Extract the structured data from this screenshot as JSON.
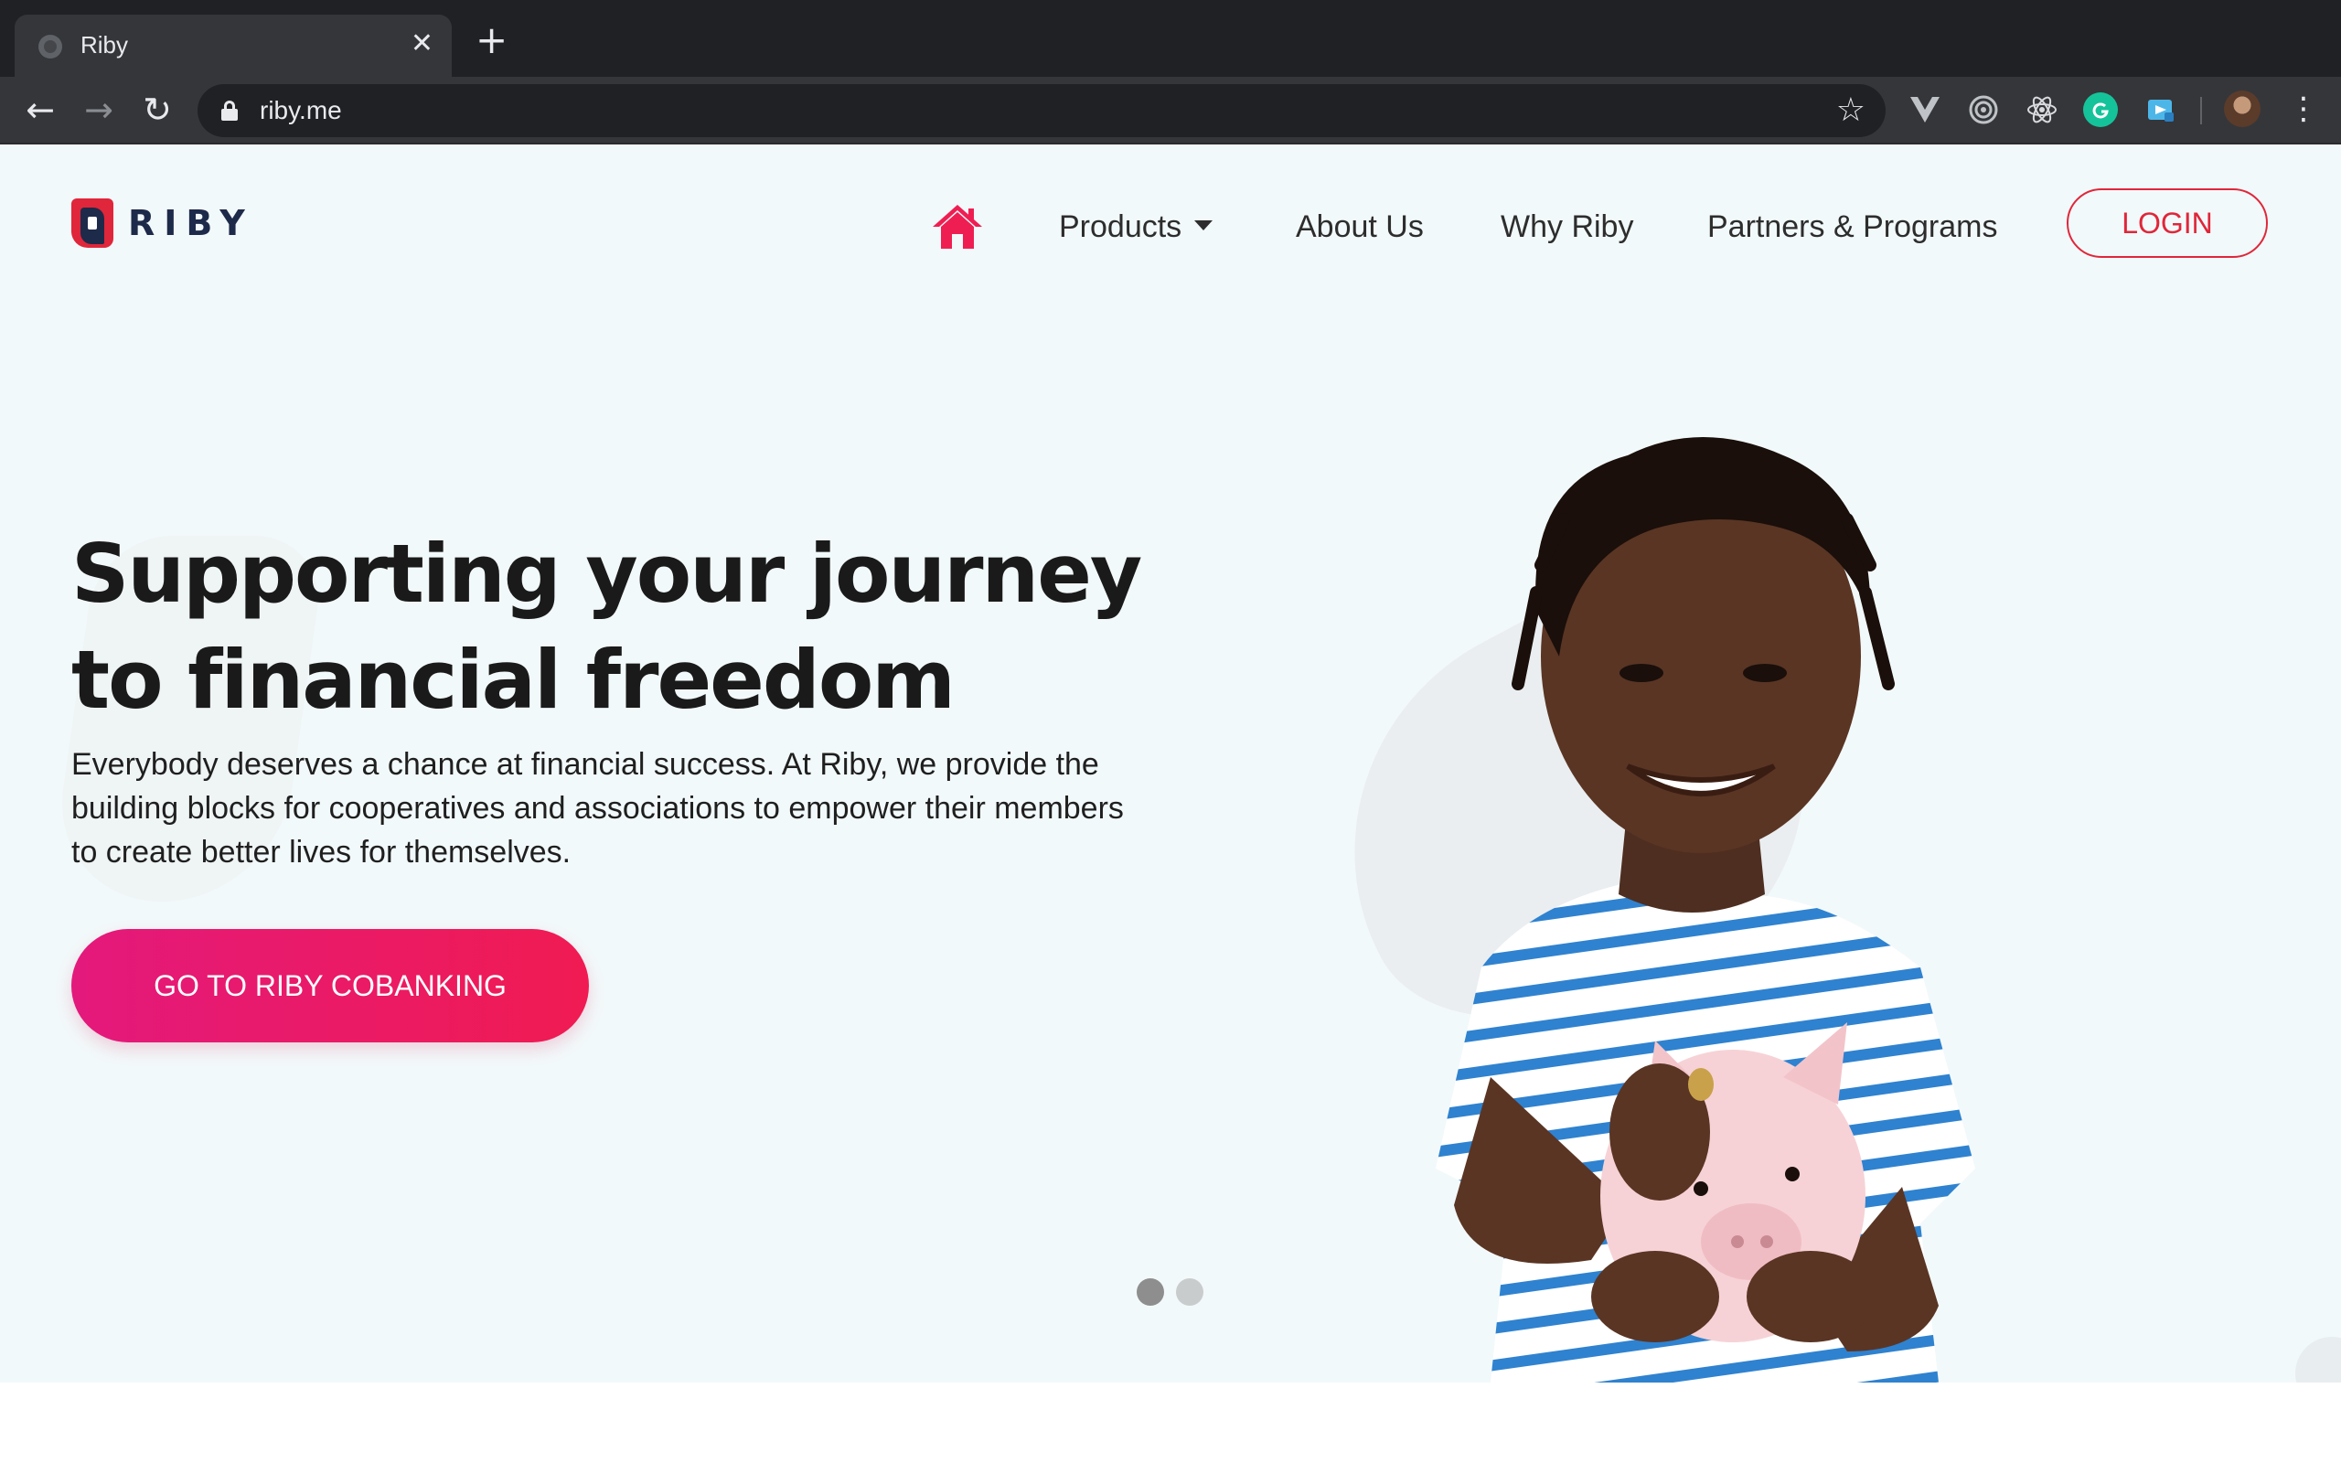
{
  "browser": {
    "tab_title": "Riby",
    "tab_close": "✕",
    "new_tab": "+",
    "url": "riby.me",
    "back": "←",
    "forward": "→",
    "reload": "↻",
    "star": "☆",
    "menu": "⋮",
    "extensions": [
      "vuejs-devtools-icon",
      "target-icon",
      "react-devtools-icon",
      "grammarly-icon",
      "screencast-icon"
    ]
  },
  "site": {
    "logo_text": "RIBY",
    "brand_color": "#e0263a",
    "brand_dark": "#1e2a4a"
  },
  "nav": {
    "products": "Products",
    "about": "About Us",
    "why": "Why Riby",
    "partners": "Partners & Programs",
    "login": "LOGIN"
  },
  "hero": {
    "title_line1": "Supporting your journey",
    "title_line2": "to financial freedom",
    "subtitle": "Everybody deserves a chance at financial success. At Riby, we provide the building blocks for cooperatives and associations to empower their members to create better lives for themselves.",
    "cta": "GO TO RIBY COBANKING"
  },
  "carousel": {
    "slides": 2,
    "active": 1
  }
}
